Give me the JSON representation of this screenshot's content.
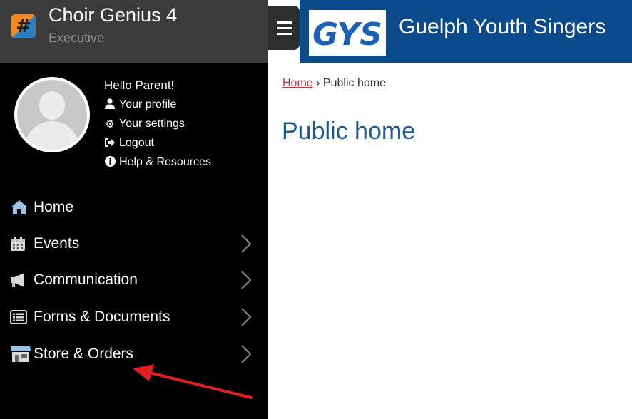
{
  "brand": {
    "logo_glyph": "#",
    "title": "Choir Genius 4",
    "subtitle": "Executive"
  },
  "user": {
    "greeting": "Hello Parent!",
    "links": [
      {
        "label": "Your profile",
        "icon": "user-icon"
      },
      {
        "label": "Your settings",
        "icon": "gear-icon"
      },
      {
        "label": "Logout",
        "icon": "logout-icon"
      },
      {
        "label": "Help & Resources",
        "icon": "info-icon"
      }
    ]
  },
  "nav": [
    {
      "label": "Home",
      "icon": "home-icon",
      "has_submenu": false
    },
    {
      "label": "Events",
      "icon": "calendar-icon",
      "has_submenu": true
    },
    {
      "label": "Communication",
      "icon": "megaphone-icon",
      "has_submenu": true
    },
    {
      "label": "Forms & Documents",
      "icon": "list-icon",
      "has_submenu": true
    },
    {
      "label": "Store & Orders",
      "icon": "store-icon",
      "has_submenu": true
    }
  ],
  "header": {
    "site_title": "Guelph Youth Singers",
    "logo_text": "GYS"
  },
  "breadcrumb": {
    "home": "Home",
    "separator": "›",
    "current": "Public home"
  },
  "page": {
    "title": "Public home"
  },
  "colors": {
    "topbar": "#0b4a8b",
    "sidebar": "#000000",
    "brand_bar": "#3b3b3b",
    "title": "#1e5a92",
    "link": "#c0353c",
    "annotation": "#e02020"
  }
}
